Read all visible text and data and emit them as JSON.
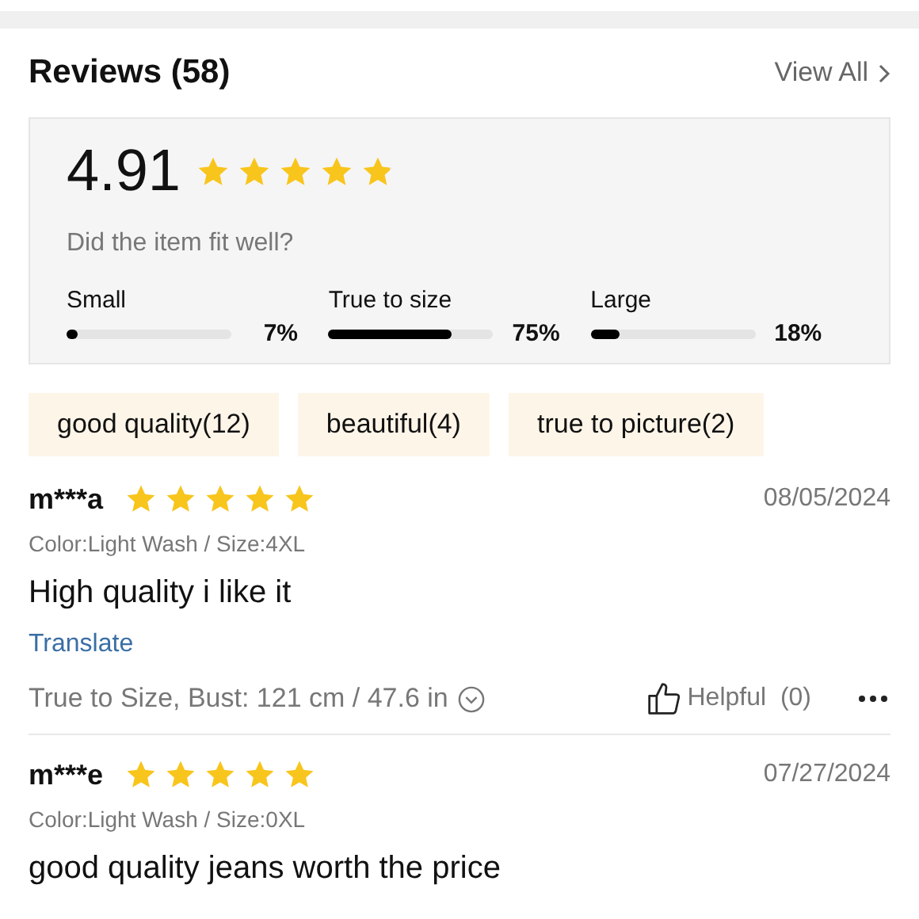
{
  "header": {
    "title": "Reviews (58)",
    "view_all": "View All"
  },
  "summary": {
    "rating": "4.91",
    "stars": 4.91,
    "fit_question": "Did the item fit well?",
    "fit": [
      {
        "label": "Small",
        "level": 0.07,
        "reading": "7%"
      },
      {
        "label": "True to size",
        "level": 0.75,
        "reading": "75%"
      },
      {
        "label": "Large",
        "level": 0.18,
        "reading": "18%"
      }
    ]
  },
  "tags": [
    "good quality(12)",
    "beautiful(4)",
    "true to picture(2)"
  ],
  "reviews": [
    {
      "user": "m***a",
      "stars": 5,
      "date": "08/05/2024",
      "variant": "Color:Light Wash / Size:4XL",
      "text": "High quality i like it",
      "translate": "Translate",
      "fit_info": "True to Size, Bust: 121 cm / 47.6 in",
      "helpful": "Helpful",
      "helpful_count": "(0)"
    },
    {
      "user": "m***e",
      "stars": 5,
      "date": "07/27/2024",
      "variant": "Color:Light Wash / Size:0XL",
      "text": "good quality jeans worth the price"
    }
  ]
}
